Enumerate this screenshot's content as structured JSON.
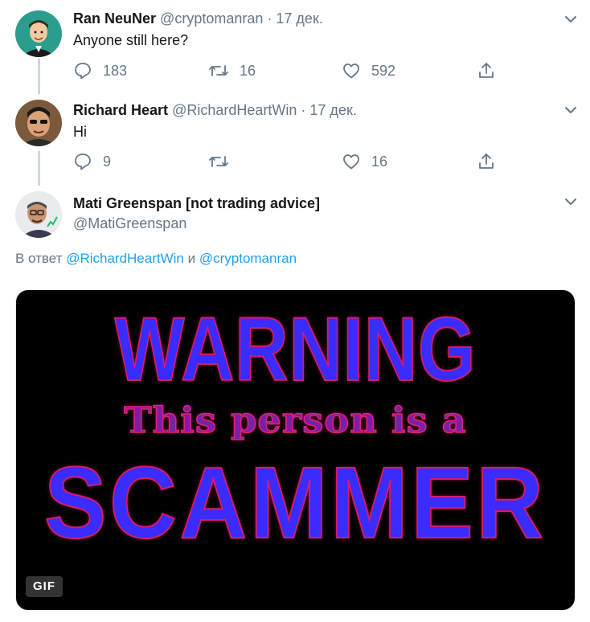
{
  "tweets": [
    {
      "name": "Ran NeuNer",
      "handle": "@cryptomanran",
      "separator": "·",
      "date": "17 дек.",
      "text": "Anyone still here?",
      "replies": "183",
      "retweets": "16",
      "likes": "592"
    },
    {
      "name": "Richard Heart",
      "handle": "@RichardHeartWin",
      "separator": "·",
      "date": "17 дек.",
      "text": "Hi",
      "replies": "9",
      "retweets": "",
      "likes": "16"
    },
    {
      "name": "Mati Greenspan [not trading advice]",
      "handle": "@MatiGreenspan"
    }
  ],
  "reply_to": {
    "prefix": "В ответ",
    "mention1": "@RichardHeartWin",
    "conjunction": "и",
    "mention2": "@cryptomanran"
  },
  "media": {
    "line1": "WARNING",
    "line2": "This person is a",
    "line3": "SCAMMER",
    "badge": "GIF"
  },
  "colors": {
    "accent": "#1da1f2",
    "muted": "#657786",
    "line": "#ccd6dd"
  },
  "icons": [
    "reply-icon",
    "retweet-icon",
    "like-icon",
    "share-icon",
    "chevron-down-icon"
  ]
}
